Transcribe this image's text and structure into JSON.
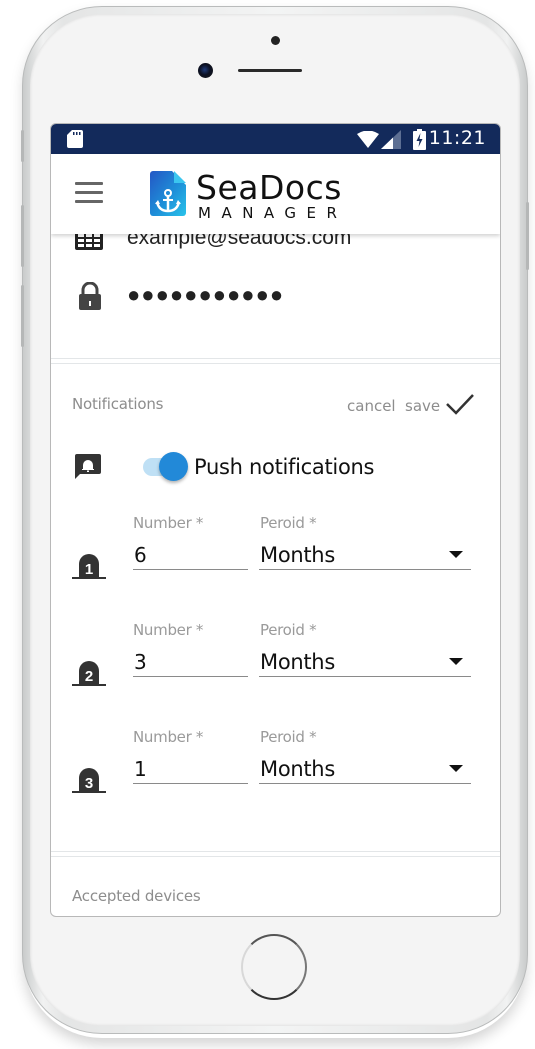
{
  "status_bar": {
    "time": "11:21",
    "icons": [
      "sd-card-icon",
      "wifi-icon",
      "cell-signal-icon",
      "battery-charging-icon"
    ]
  },
  "app_bar": {
    "menu_icon": "hamburger-menu-icon",
    "logo_title": "SeaDocs",
    "logo_subtitle": "MANAGER"
  },
  "account": {
    "email": "example@seadocs.com",
    "password_masked": "●●●●●●●●●●●"
  },
  "notifications": {
    "section_title": "Notifications",
    "cancel_label": "cancel",
    "save_label": "save",
    "push": {
      "label": "Push notifications",
      "enabled": true
    },
    "reminders": [
      {
        "index": "1",
        "number_label": "Number *",
        "number_value": "6",
        "period_label": "Peroid *",
        "period_value": "Months"
      },
      {
        "index": "2",
        "number_label": "Number *",
        "number_value": "3",
        "period_label": "Peroid *",
        "period_value": "Months"
      },
      {
        "index": "3",
        "number_label": "Number *",
        "number_value": "1",
        "period_label": "Peroid *",
        "period_value": "Months"
      }
    ]
  },
  "devices": {
    "section_title": "Accepted devices"
  },
  "colors": {
    "status_bar": "#132a5b",
    "accent": "#2289d8",
    "toggle_track": "#bfe0f5",
    "secondary_text": "#8d8d8d"
  }
}
